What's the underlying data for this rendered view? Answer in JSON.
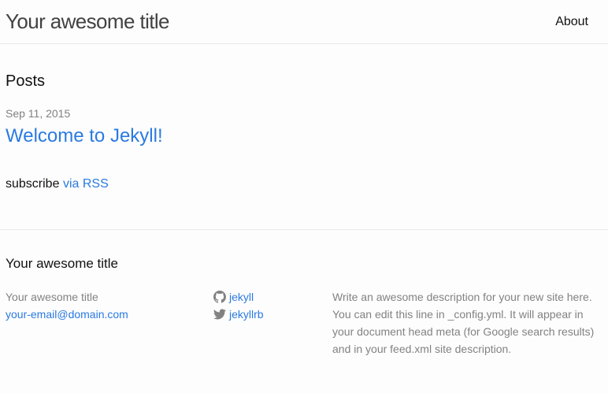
{
  "header": {
    "site_title": "Your awesome title",
    "nav": [
      {
        "label": "About"
      }
    ]
  },
  "main": {
    "posts_heading": "Posts",
    "posts": [
      {
        "date": "Sep 11, 2015",
        "title": "Welcome to Jekyll!"
      }
    ],
    "rss_prefix": "subscribe",
    "rss_link": "via RSS"
  },
  "footer": {
    "heading": "Your awesome title",
    "name": "Your awesome title",
    "email": "your-email@domain.com",
    "social": [
      {
        "icon": "github-icon",
        "username": "jekyll"
      },
      {
        "icon": "twitter-icon",
        "username": "jekyllrb"
      }
    ],
    "description": "Write an awesome description for your new site here. You can edit this line in _config.yml. It will appear in your document head meta (for Google search results) and in your feed.xml site description."
  },
  "colors": {
    "link": "#2a7ae2",
    "meta_text": "#828282",
    "icon": "#828282",
    "border": "#e8e8e8",
    "background": "#fdfdfd"
  }
}
